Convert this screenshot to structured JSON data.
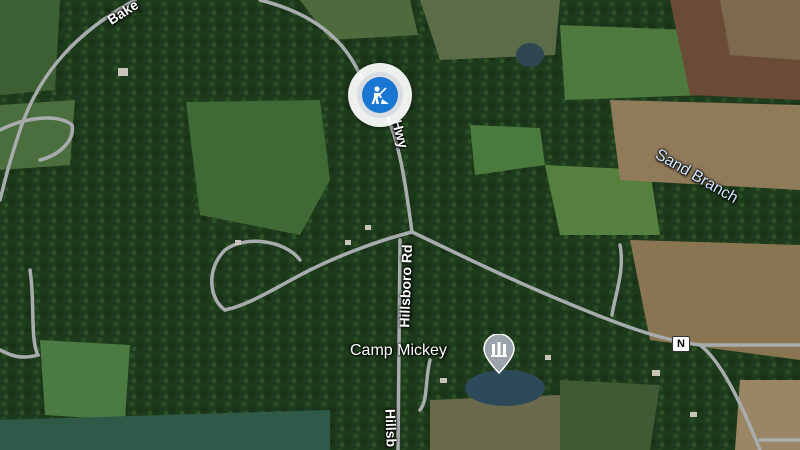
{
  "map": {
    "road_labels": {
      "bake": "Bake",
      "hwy": "Hwy",
      "hillsboro_rd_1": "Hillsboro Rd",
      "hillsboro_rd_2": "Hillsb"
    },
    "water_label": "Sand Branch",
    "poi": {
      "label": "Camp Mickey",
      "icon": "monument-icon"
    },
    "route_shield": "N",
    "marker": {
      "icon": "construction-worker-icon",
      "color": "#1976d2"
    }
  }
}
